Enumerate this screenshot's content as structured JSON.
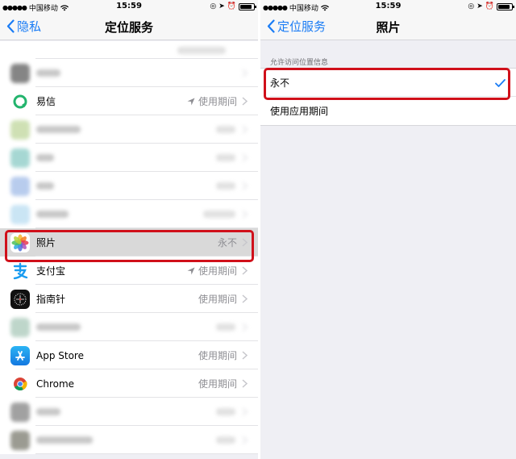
{
  "status_bar": {
    "carrier": "中国移动",
    "time": "15:59"
  },
  "left_screen": {
    "back_label": "隐私",
    "title": "定位服务",
    "rows": [
      {
        "label": "易信",
        "value": "使用期间",
        "location_arrow": true,
        "icon": "yixin-icon"
      },
      {
        "label": "照片",
        "value": "永不",
        "location_arrow": false,
        "icon": "photos-icon",
        "highlighted": true
      },
      {
        "label": "支付宝",
        "value": "使用期间",
        "location_arrow": true,
        "icon": "alipay-icon"
      },
      {
        "label": "指南针",
        "value": "使用期间",
        "location_arrow": false,
        "icon": "compass-icon"
      },
      {
        "label": "App Store",
        "value": "使用期间",
        "location_arrow": false,
        "icon": "app-store-icon"
      },
      {
        "label": "Chrome",
        "value": "使用期间",
        "location_arrow": false,
        "icon": "chrome-icon"
      }
    ]
  },
  "right_screen": {
    "back_label": "定位服务",
    "title": "照片",
    "section_header": "允许访问位置信息",
    "options": [
      {
        "label": "永不",
        "selected": true
      },
      {
        "label": "使用应用期间",
        "selected": false
      }
    ]
  },
  "colors": {
    "accent": "#1a7cf5",
    "highlight_border": "#d0101a",
    "secondary_text": "#8e8e93",
    "background": "#efeff4"
  }
}
